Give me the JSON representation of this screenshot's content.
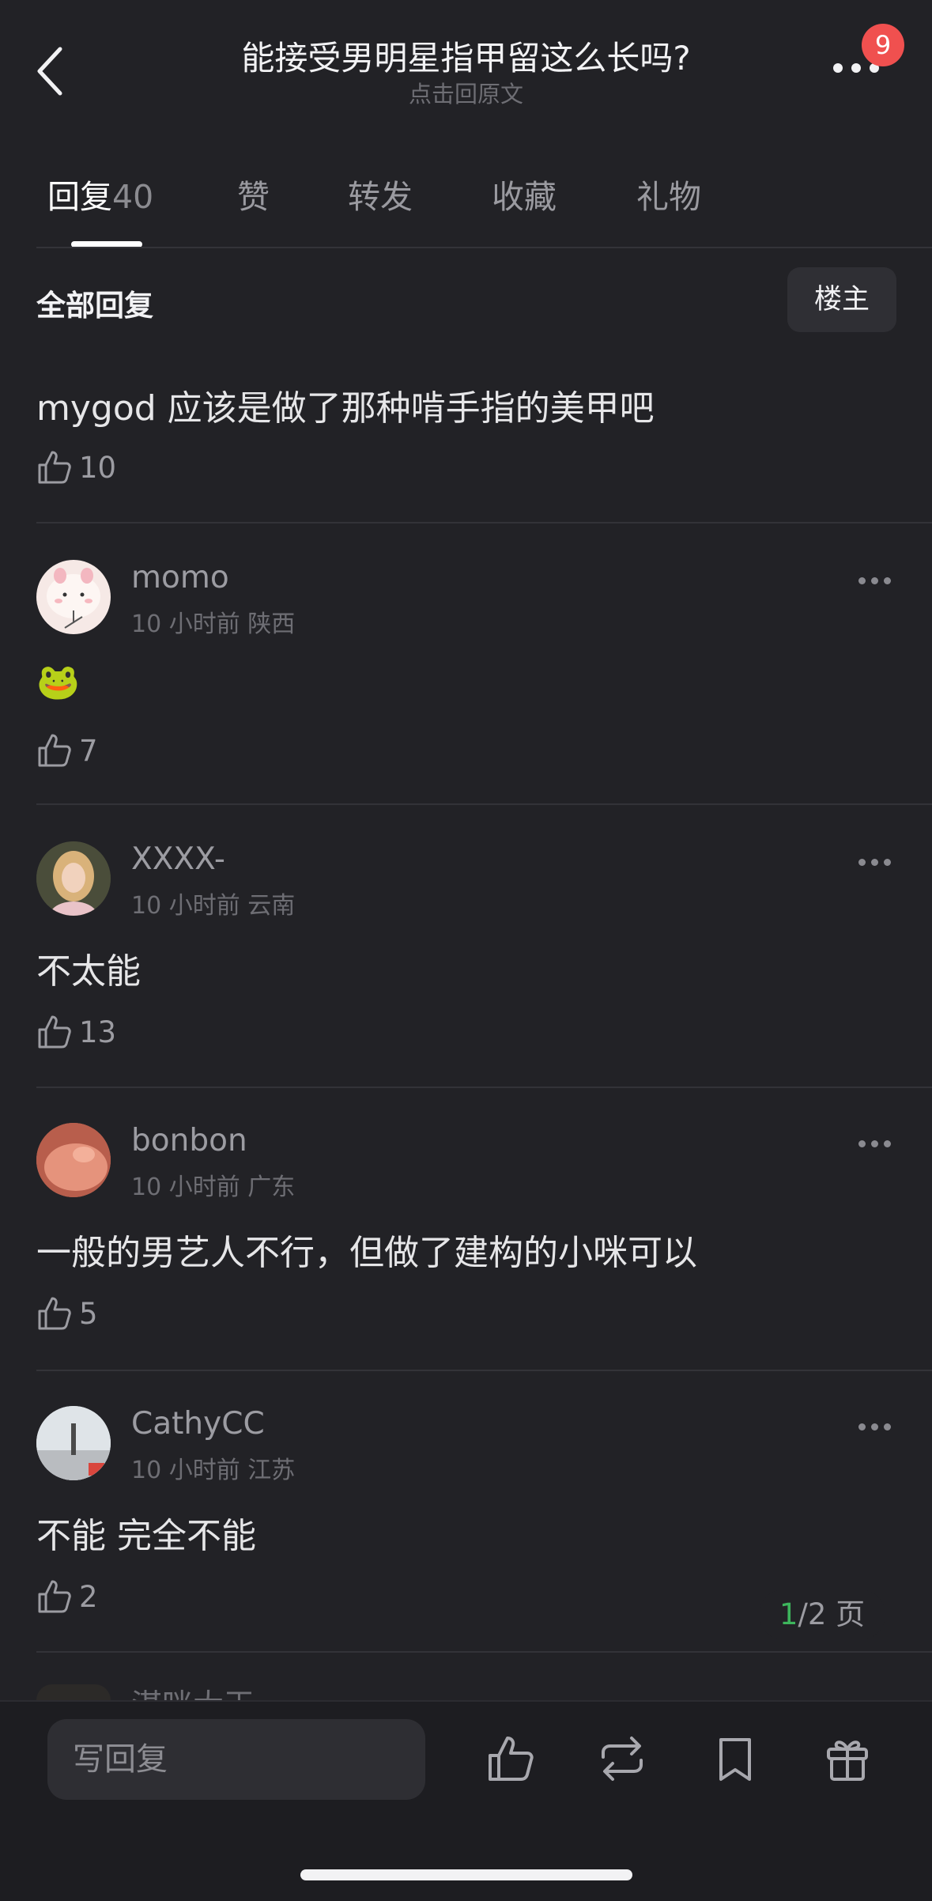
{
  "header": {
    "title": "能接受男明星指甲留这么长吗?",
    "subtitle": "点击回原文",
    "badge": "9"
  },
  "tabs": [
    {
      "label": "回复",
      "count": "40",
      "active": true
    },
    {
      "label": "赞"
    },
    {
      "label": "转发"
    },
    {
      "label": "收藏"
    },
    {
      "label": "礼物"
    }
  ],
  "section": {
    "title": "全部回复",
    "filter_button": "楼主"
  },
  "op_reply": {
    "text": "mygod 应该是做了那种啃手指的美甲吧",
    "likes": "10"
  },
  "comments": [
    {
      "user": "momo",
      "time": "10 小时前",
      "region": "陕西",
      "text": "🐸",
      "likes": "7"
    },
    {
      "user": "XXXX-",
      "time": "10 小时前",
      "region": "云南",
      "text": "不太能",
      "likes": "13"
    },
    {
      "user": "bonbon",
      "time": "10 小时前",
      "region": "广东",
      "text": "一般的男艺人不行，但做了建构的小咪可以",
      "likes": "5"
    },
    {
      "user": "CathyCC",
      "time": "10 小时前",
      "region": "江苏",
      "text": "不能 完全不能",
      "likes": "2"
    }
  ],
  "partial_user": "湛咪大王",
  "pager": {
    "current": "1",
    "total": "/2 页"
  },
  "bottom": {
    "reply_placeholder": "写回复"
  }
}
